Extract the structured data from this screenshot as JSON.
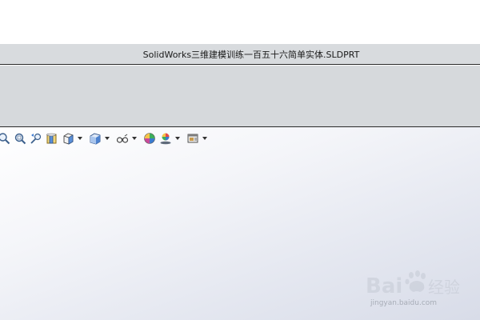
{
  "window": {
    "title": "SolidWorks三维建模训练一百五十六简单实体.SLDPRT"
  },
  "heads_up_toolbar": {
    "items": [
      {
        "icon": "zoom-to-fit-icon"
      },
      {
        "icon": "zoom-to-area-icon"
      },
      {
        "icon": "previous-view-icon"
      },
      {
        "icon": "section-view-icon"
      },
      {
        "icon": "view-orientation-icon"
      },
      {
        "icon": "display-style-icon"
      },
      {
        "icon": "hide-show-items-icon"
      },
      {
        "icon": "edit-appearance-icon"
      },
      {
        "icon": "apply-scene-icon"
      },
      {
        "icon": "view-settings-icon"
      }
    ]
  },
  "watermark": {
    "brand": "Bai经验",
    "url": "jingyan.baidu.com"
  }
}
